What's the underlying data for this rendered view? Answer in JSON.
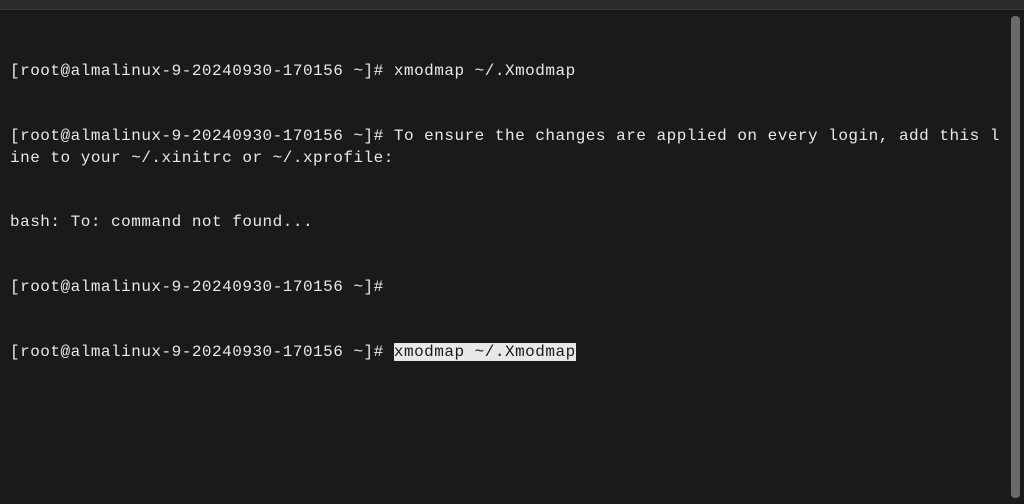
{
  "prompt": "[root@almalinux-9-20240930-170156 ~]# ",
  "lines": {
    "l1_cmd": "xmodmap ~/.Xmodmap",
    "l2_cmd": "To ensure the changes are applied on every login, add this line to your ~/.xinitrc or ~/.xprofile:",
    "l3": "bash: To: command not found...",
    "l4_cmd": "",
    "l5_cmd_selected": "xmodmap ~/.Xmodmap"
  }
}
